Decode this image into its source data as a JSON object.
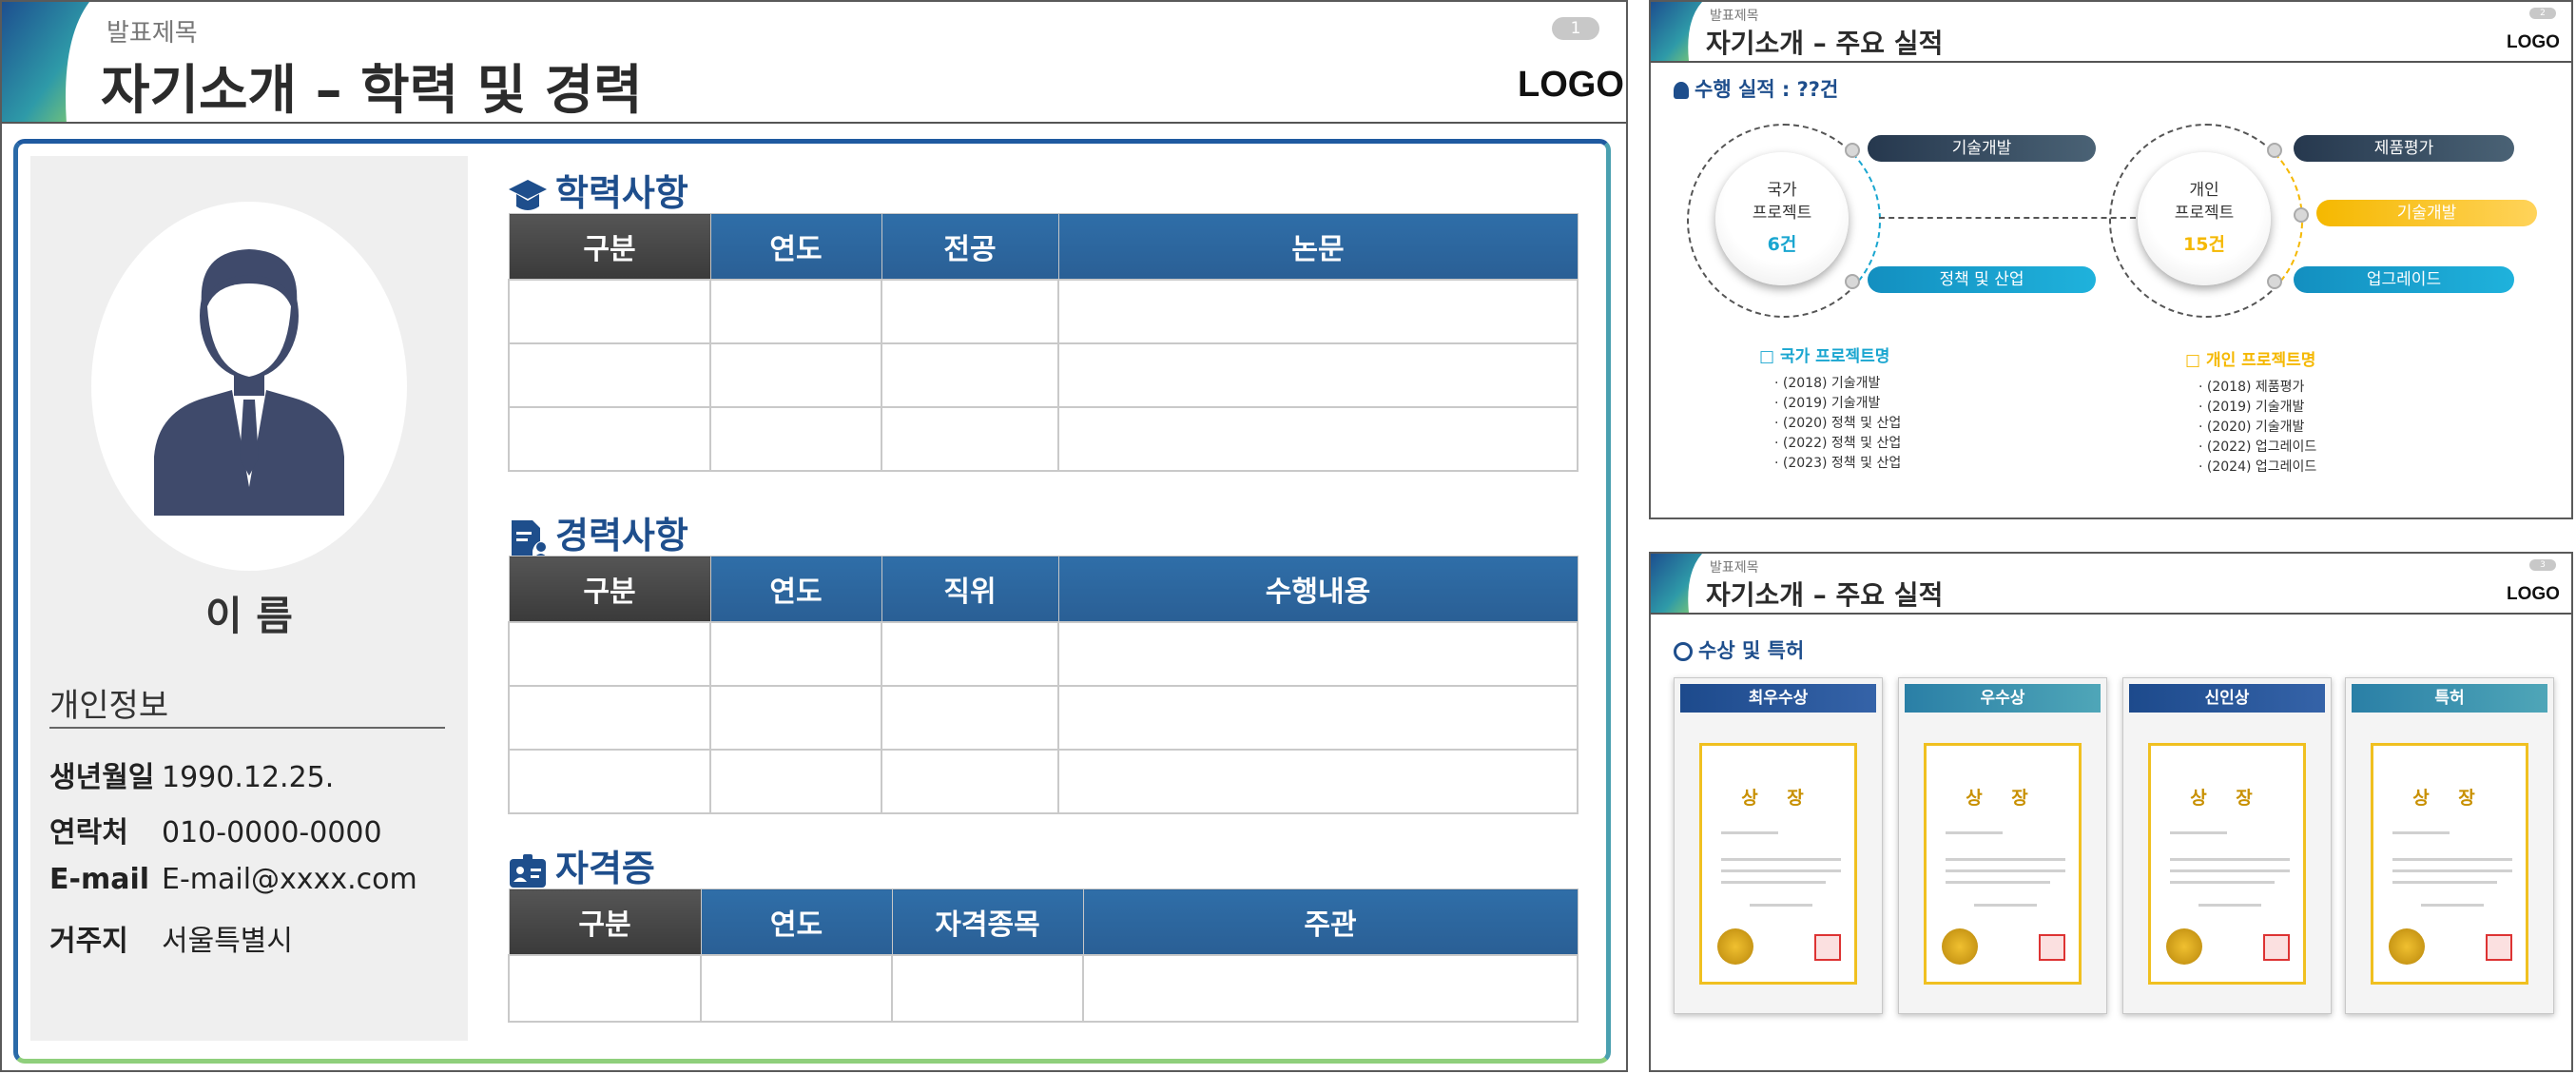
{
  "slide1": {
    "subtitle": "발표제목",
    "title": "자기소개 – 학력 및 경력",
    "page": "1",
    "logo": "LOGO",
    "profile": {
      "name": "이 름",
      "info_title": "개인정보",
      "fields": [
        {
          "key": "생년월일",
          "value": "1990.12.25."
        },
        {
          "key": "연락처",
          "value": "010-0000-0000"
        },
        {
          "key": "E-mail",
          "value": "E-mail@xxxx.com"
        },
        {
          "key": "거주지",
          "value": "서울특별시"
        }
      ]
    },
    "education": {
      "title": "학력사항",
      "headers": [
        "구분",
        "연도",
        "전공",
        "논문"
      ]
    },
    "career": {
      "title": "경력사항",
      "headers": [
        "구분",
        "연도",
        "직위",
        "수행내용"
      ]
    },
    "license": {
      "title": "자격증",
      "headers": [
        "구분",
        "연도",
        "자격종목",
        "주관"
      ]
    }
  },
  "slide2": {
    "subtitle": "발표제목",
    "title": "자기소개 – 주요 실적",
    "page": "2",
    "logo": "LOGO",
    "heading": "수행 실적 : ??건",
    "national": {
      "label_line1": "국가",
      "label_line2": "프로젝트",
      "count": "6건",
      "pills": [
        "기술개발",
        "정책 및 산업"
      ],
      "list_title": "□ 국가 프로젝트명",
      "items": [
        "(2018) 기술개발",
        "(2019) 기술개발",
        "(2020) 정책 및 산업",
        "(2022) 정책 및 산업",
        "(2023) 정책 및 산업"
      ]
    },
    "personal": {
      "label_line1": "개인",
      "label_line2": "프로젝트",
      "count": "15건",
      "pills": [
        "제품평가",
        "기술개발",
        "업그레이드"
      ],
      "list_title": "□ 개인 프로젝트명",
      "items": [
        "(2018) 제품평가",
        "(2019) 기술개발",
        "(2020) 기술개발",
        "(2022) 업그레이드",
        "(2024) 업그레이드"
      ]
    },
    "colors": {
      "navy": "#2c3e50",
      "cyan": "#1aa6d0",
      "gold": "#f5b800"
    }
  },
  "slide3": {
    "subtitle": "발표제목",
    "title": "자기소개 – 주요 실적",
    "page": "3",
    "logo": "LOGO",
    "heading": "수상 및 특허",
    "cards": [
      {
        "label": "최우수상",
        "cert_title": "상 장"
      },
      {
        "label": "우수상",
        "cert_title": "상 장"
      },
      {
        "label": "신인상",
        "cert_title": "상 장"
      },
      {
        "label": "특허",
        "cert_title": "상 장"
      }
    ]
  }
}
